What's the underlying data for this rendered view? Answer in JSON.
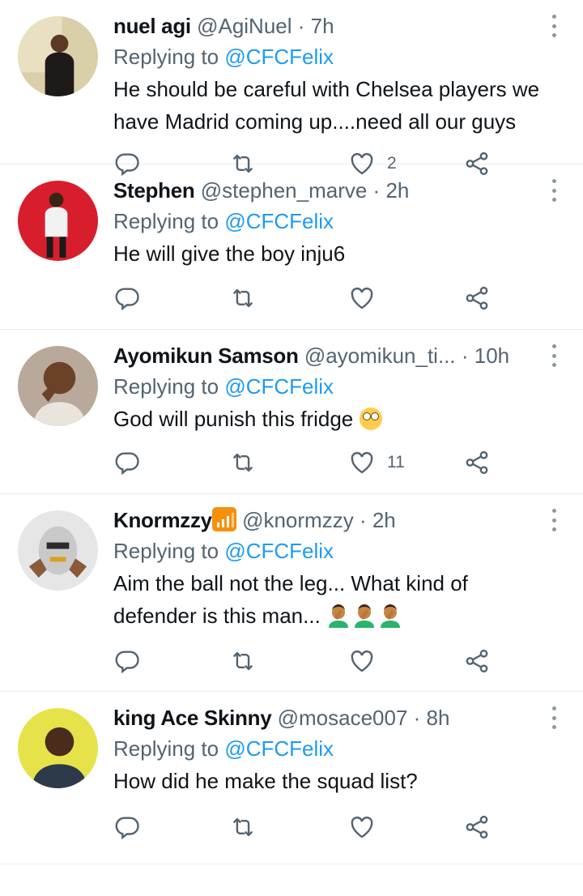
{
  "tweets": [
    {
      "name": "nuel agi",
      "handle": "@AgiNuel",
      "sep": " · ",
      "time": "7h",
      "reply_prefix": "Replying to",
      "reply_to": "@CFCFelix",
      "text_lines": [
        "He should be careful with Chelsea players we",
        "have Madrid coming up....need all our guys"
      ],
      "likes": "2",
      "avatar_icon": "person-photo-avatar"
    },
    {
      "name": "Stephen",
      "handle": "@stephen_marve",
      "sep": " · ",
      "time": "2h",
      "reply_prefix": "Replying to",
      "reply_to": "@CFCFelix",
      "text_lines": [
        "He will give the boy inju6"
      ],
      "likes": "",
      "avatar_icon": "person-photo-avatar"
    },
    {
      "name": "Ayomikun Samson",
      "handle": "@ayomikun_ti...",
      "sep": " · ",
      "time": "10h",
      "reply_prefix": "Replying to",
      "reply_to": "@CFCFelix",
      "text_lines": [
        "God will punish this fridge"
      ],
      "likes": "11",
      "emoji": "face-with-rolling-eyes",
      "avatar_icon": "person-photo-avatar"
    },
    {
      "name": "Knormzzy",
      "handle": "@knormzzy",
      "sep": " · ",
      "time": "2h",
      "reply_prefix": "Replying to",
      "reply_to": "@CFCFelix",
      "text_lines": [
        "Aim the ball not the leg... What kind of",
        "defender is this man..."
      ],
      "likes": "",
      "name_badge": "antenna-bars-emoji",
      "trailing_emoji": "man-facepalming",
      "avatar_icon": "person-photo-avatar"
    },
    {
      "name": "king Ace Skinny",
      "handle": "@mosace007",
      "sep": " · ",
      "time": "8h",
      "reply_prefix": "Replying to",
      "reply_to": "@CFCFelix",
      "text_lines": [
        "How did he make the squad list?"
      ],
      "likes": "",
      "avatar_icon": "person-photo-avatar"
    }
  ],
  "icons": {
    "reply": "reply-icon",
    "retweet": "retweet-icon",
    "like": "heart-icon",
    "share": "share-icon",
    "more": "more-options-icon"
  },
  "colors": {
    "link": "#1d9bf0",
    "secondary": "#536471",
    "text": "#0f1419",
    "divider": "#e6ecf0"
  }
}
